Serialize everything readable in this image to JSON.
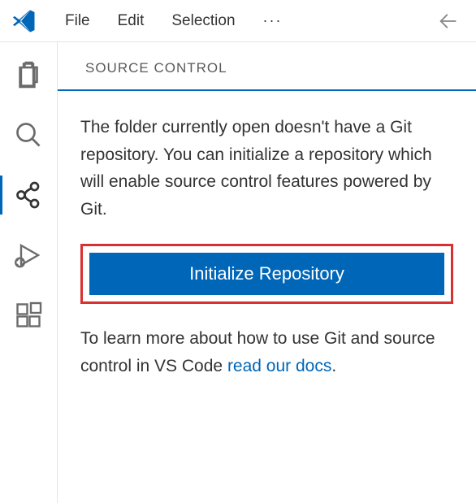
{
  "menubar": {
    "items": [
      "File",
      "Edit",
      "Selection"
    ],
    "more": "···"
  },
  "panel": {
    "title": "SOURCE CONTROL",
    "info_text": "The folder currently open doesn't have a Git repository. You can initialize a repository which will enable source control features powered by Git.",
    "init_button": "Initialize Repository",
    "learn_prefix": "To learn more about how to use Git and source control in VS Code ",
    "learn_link": "read our docs",
    "learn_suffix": "."
  },
  "colors": {
    "accent": "#0066b8",
    "highlight": "#d93030"
  }
}
